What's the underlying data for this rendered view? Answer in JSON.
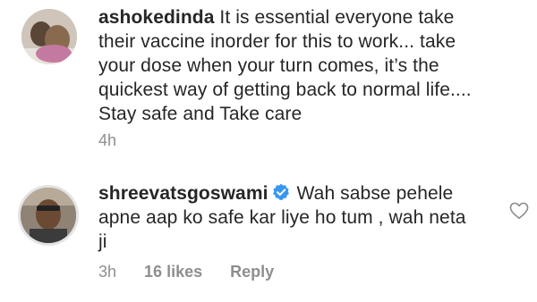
{
  "comments": [
    {
      "username": "ashokedinda",
      "text": "It is essential everyone take their vaccine inorder for this to work... take your dose when your turn comes, it’s the quickest way of getting back to normal life.... Stay safe and Take care",
      "time": "4h"
    },
    {
      "username": "shreevatsgoswami",
      "verified": true,
      "text": "Wah sabse pehele apne aap ko safe kar liye ho tum , wah neta ji",
      "time": "3h",
      "likes": "16 likes",
      "reply_label": "Reply"
    }
  ],
  "colors": {
    "text": "#262626",
    "meta": "#8e8e8e",
    "verified": "#3897f0"
  },
  "icons": [
    "verified-badge-icon",
    "heart-icon"
  ]
}
